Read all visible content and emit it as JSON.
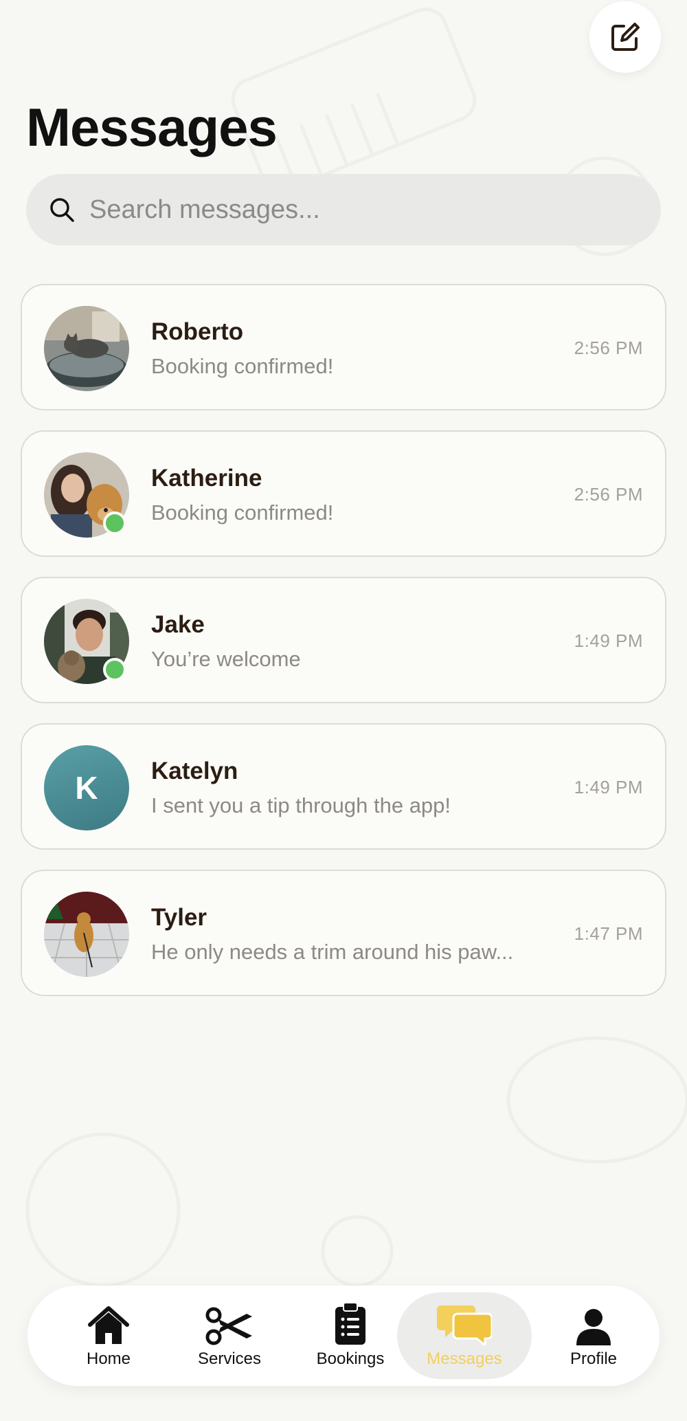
{
  "header": {
    "title": "Messages",
    "compose_icon": "compose-icon"
  },
  "search": {
    "placeholder": "Search messages...",
    "icon": "search-icon"
  },
  "conversations": [
    {
      "name": "Roberto",
      "preview": "Booking confirmed!",
      "time": "2:56 PM",
      "online": false,
      "avatar": "photo-cat"
    },
    {
      "name": "Katherine",
      "preview": "Booking confirmed!",
      "time": "2:56 PM",
      "online": true,
      "avatar": "photo-woman-dog"
    },
    {
      "name": "Jake",
      "preview": "You’re welcome",
      "time": "1:49 PM",
      "online": true,
      "avatar": "photo-man-cat"
    },
    {
      "name": "Katelyn",
      "preview": "I sent you a tip through the app!",
      "time": "1:49 PM",
      "online": false,
      "avatar_letter": "K"
    },
    {
      "name": "Tyler",
      "preview": "He only needs a trim around his paw...",
      "time": "1:47 PM",
      "online": false,
      "avatar": "photo-dog"
    }
  ],
  "tabbar": {
    "items": [
      {
        "label": "Home",
        "icon": "home-icon"
      },
      {
        "label": "Services",
        "icon": "scissors-icon"
      },
      {
        "label": "Bookings",
        "icon": "clipboard-icon"
      },
      {
        "label": "Messages",
        "icon": "chat-bubbles-icon",
        "active": true
      },
      {
        "label": "Profile",
        "icon": "person-icon"
      }
    ]
  },
  "colors": {
    "background": "#f7f7f4",
    "accent": "#f3cf5c",
    "online": "#5cc35f",
    "text": "#2b1d12"
  }
}
